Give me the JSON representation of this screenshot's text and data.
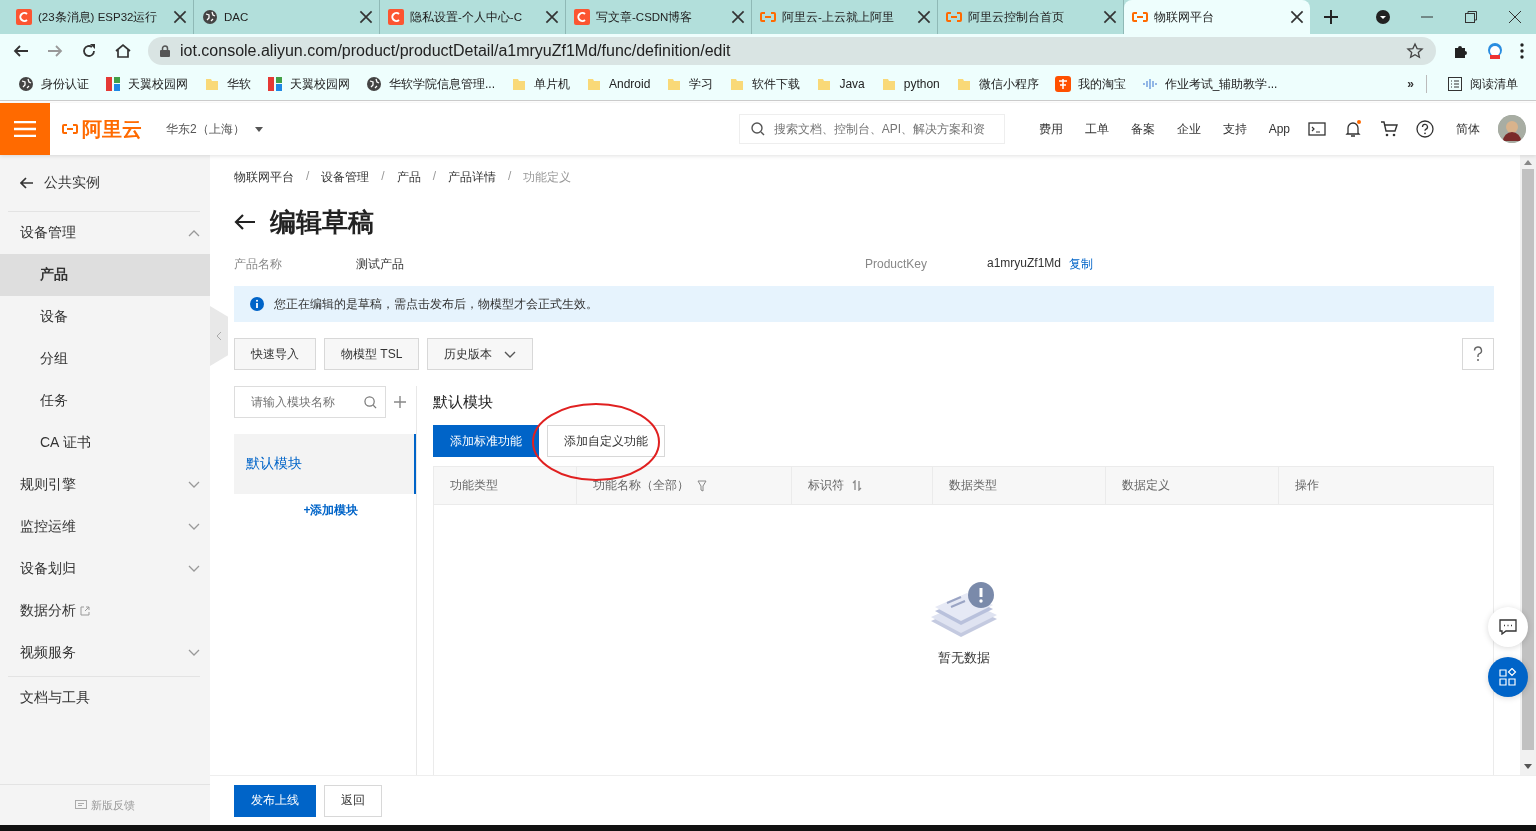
{
  "browser": {
    "tabs": [
      {
        "title": "(23条消息) ESP32运行",
        "kind": "csdn",
        "selected": false
      },
      {
        "title": "DAC",
        "kind": "globe",
        "selected": false
      },
      {
        "title": "隐私设置-个人中心-C",
        "kind": "csdn",
        "selected": false
      },
      {
        "title": "写文章-CSDN博客",
        "kind": "csdn",
        "selected": false
      },
      {
        "title": "阿里云-上云就上阿里",
        "kind": "aliyun",
        "selected": false
      },
      {
        "title": "阿里云控制台首页",
        "kind": "aliyun",
        "selected": false
      },
      {
        "title": "物联网平台",
        "kind": "aliyun",
        "selected": true
      }
    ],
    "url": "iot.console.aliyun.com/product/productDetail/a1mryuZf1Md/func/definition/edit",
    "bookmarks": [
      {
        "label": "身份认证",
        "kind": "globe"
      },
      {
        "label": "天翼校园网",
        "kind": "tiles"
      },
      {
        "label": "华软",
        "kind": "folder"
      },
      {
        "label": "天翼校园网",
        "kind": "tiles"
      },
      {
        "label": "华软学院信息管理...",
        "kind": "globe"
      },
      {
        "label": "单片机",
        "kind": "folder"
      },
      {
        "label": "Android",
        "kind": "folder"
      },
      {
        "label": "学习",
        "kind": "folder"
      },
      {
        "label": "软件下载",
        "kind": "folder"
      },
      {
        "label": "Java",
        "kind": "folder"
      },
      {
        "label": "python",
        "kind": "folder"
      },
      {
        "label": "微信小程序",
        "kind": "folder"
      },
      {
        "label": "我的淘宝",
        "kind": "taobao"
      },
      {
        "label": "作业考试_辅助教学...",
        "kind": "wave"
      }
    ],
    "overflow": "»",
    "reading_list": "阅读清单"
  },
  "header": {
    "logo": "阿里云",
    "region": "华东2（上海）",
    "search": {
      "placeholder": "搜索文档、控制台、API、解决方案和资"
    },
    "links": [
      "费用",
      "工单",
      "备案",
      "企业",
      "支持",
      "App"
    ],
    "language": "简体",
    "notification": true
  },
  "sidebar": {
    "back": "公共实例",
    "items": [
      {
        "label": "设备管理",
        "expanded": true,
        "children": [
          {
            "label": "产品",
            "selected": true
          },
          {
            "label": "设备",
            "selected": false
          },
          {
            "label": "分组",
            "selected": false
          },
          {
            "label": "任务",
            "selected": false
          },
          {
            "label": "CA 证书",
            "selected": false
          }
        ]
      },
      {
        "label": "规则引擎",
        "expanded": false
      },
      {
        "label": "监控运维",
        "expanded": false
      },
      {
        "label": "设备划归",
        "expanded": false
      },
      {
        "label": "数据分析",
        "kind": "external"
      },
      {
        "label": "视频服务",
        "expanded": false
      },
      {
        "label": "文档与工具",
        "kind": "divided"
      }
    ],
    "feedback": "新版反馈"
  },
  "breadcrumb": [
    "物联网平台",
    "设备管理",
    "产品",
    "产品详情",
    "功能定义"
  ],
  "breadcrumb_separator": "/",
  "title": "编辑草稿",
  "info": [
    {
      "label": "产品名称",
      "value": "测试产品"
    },
    {
      "label": "ProductKey",
      "value": "a1mryuZf1Md",
      "action": "复制"
    }
  ],
  "alert": "您正在编辑的是草稿，需点击发布后，物模型才会正式生效。",
  "toolbar": [
    {
      "label": "快速导入",
      "kind": "plain"
    },
    {
      "label": "物模型 TSL",
      "kind": "plain"
    },
    {
      "label": "历史版本",
      "kind": "dropdown"
    }
  ],
  "modules": {
    "search": {
      "placeholder": "请输入模块名称"
    },
    "items": [
      {
        "label": "默认模块",
        "selected": true
      }
    ],
    "add": "+添加模块"
  },
  "module_title": "默认模块",
  "actions": [
    {
      "label": "添加标准功能",
      "kind": "primary"
    },
    {
      "label": "添加自定义功能",
      "kind": "secondary"
    }
  ],
  "table": {
    "columns": [
      {
        "label": "功能类型",
        "kind": "plain"
      },
      {
        "label": "功能名称（全部）",
        "kind": "filter"
      },
      {
        "label": "标识符",
        "kind": "sort"
      },
      {
        "label": "数据类型",
        "kind": "plain"
      },
      {
        "label": "数据定义",
        "kind": "plain"
      },
      {
        "label": "操作",
        "kind": "plain"
      }
    ],
    "empty": "暂无数据"
  },
  "footer": [
    {
      "label": "发布上线",
      "kind": "primary"
    },
    {
      "label": "返回",
      "kind": "secondary"
    }
  ]
}
